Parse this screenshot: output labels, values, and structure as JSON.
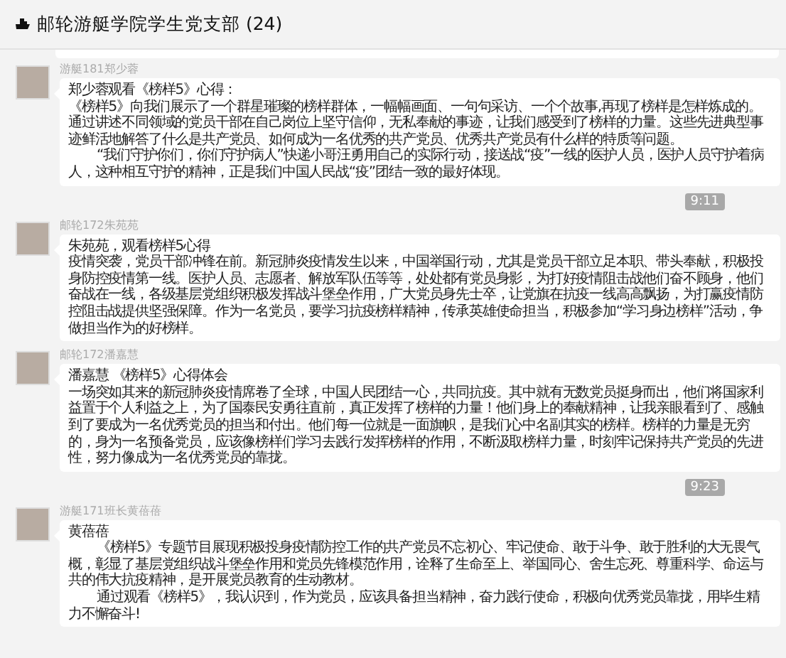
{
  "window": {
    "title": "邮轮游艇学院学生党支部 (24)"
  },
  "messages": [
    {
      "kind": "message",
      "sender": "游艇181郑少蓉",
      "title": "郑少蓉观看《榜样5》心得：",
      "paragraphs": [
        {
          "text": "《榜样5》向我们展示了一个群星璀璨的榜样群体，一幅幅画面、一句句采访、一个个故事,再现了榜样是怎样炼成的。通过讲述不同领域的党员干部在自己岗位上坚守信仰，无私奉献的事迹，让我们感受到了榜样的力量。这些先进典型事迹鲜活地解答了什么是共产党员、如何成为一名优秀的共产党员、优秀共产党员有什么样的特质等问题。",
          "indent": false
        },
        {
          "text": "“我们守护你们，你们守护病人”快递小哥汪勇用自己的实际行动，接送战“疫”一线的医护人员，医护人员守护着病人，这种相互守护的精神，正是我们中国人民战“疫”团结一致的最好体现。",
          "indent": true
        }
      ]
    },
    {
      "kind": "time",
      "text": "9:11"
    },
    {
      "kind": "message",
      "sender": "邮轮172朱苑苑",
      "title": "朱苑苑，观看榜样5心得",
      "paragraphs": [
        {
          "text": "疫情突袭，党员干部冲锋在前。新冠肺炎疫情发生以来，中国举国行动，尤其是党员干部立足本职、带头奉献，积极投身防控疫情第一线。医护人员、志愿者、解放军队伍等等，处处都有党员身影，为打好疫情阻击战他们奋不顾身，他们奋战在一线，各级基层党组织积极发挥战斗堡垒作用，广大党员身先士卒，让党旗在抗疫一线高高飘扬，为打赢疫情防控阻击战提供坚强保障。作为一名党员，要学习抗疫榜样精神，传承英雄使命担当，积极参加“学习身边榜样”活动，争做担当作为的好榜样。",
          "indent": false
        }
      ]
    },
    {
      "kind": "message",
      "sender": "邮轮172潘嘉慧",
      "title": "潘嘉慧 《榜样5》心得体会",
      "paragraphs": [
        {
          "text": "一场突如其来的新冠肺炎疫情席卷了全球，中国人民团结一心，共同抗疫。其中就有无数党员挺身而出，他们将国家利益置于个人利益之上，为了国泰民安勇往直前，真正发挥了榜样的力量！他们身上的奉献精神，让我亲眼看到了、感触到了要成为一名优秀党员的担当和付出。他们每一位就是一面旗帜，是我们心中名副其实的榜样。榜样的力量是无穷的，身为一名预备党员，应该像榜样们学习去践行发挥榜样的作用，不断汲取榜样力量，时刻牢记保持共产党员的先进性，努力像成为一名优秀党员的靠拢。",
          "indent": false
        }
      ]
    },
    {
      "kind": "time",
      "text": "9:23"
    },
    {
      "kind": "message",
      "sender": "游艇171班长黄蓓蓓",
      "title": "黄蓓蓓",
      "paragraphs": [
        {
          "text": "《榜样5》专题节目展现积极投身疫情防控工作的共产党员不忘初心、牢记使命、敢于斗争、敢于胜利的大无畏气概，彰显了基层党组织战斗堡垒作用和党员先锋模范作用，诠释了生命至上、举国同心、舍生忘死、尊重科学、命运与共的伟大抗疫精神，是开展党员教育的生动教材。",
          "indent": true
        },
        {
          "text": "通过观看《榜样5》，我认识到，作为党员，应该具备担当精神，奋力践行使命，积极向优秀党员靠拢，用毕生精力不懈奋斗!",
          "indent": true
        }
      ]
    }
  ]
}
